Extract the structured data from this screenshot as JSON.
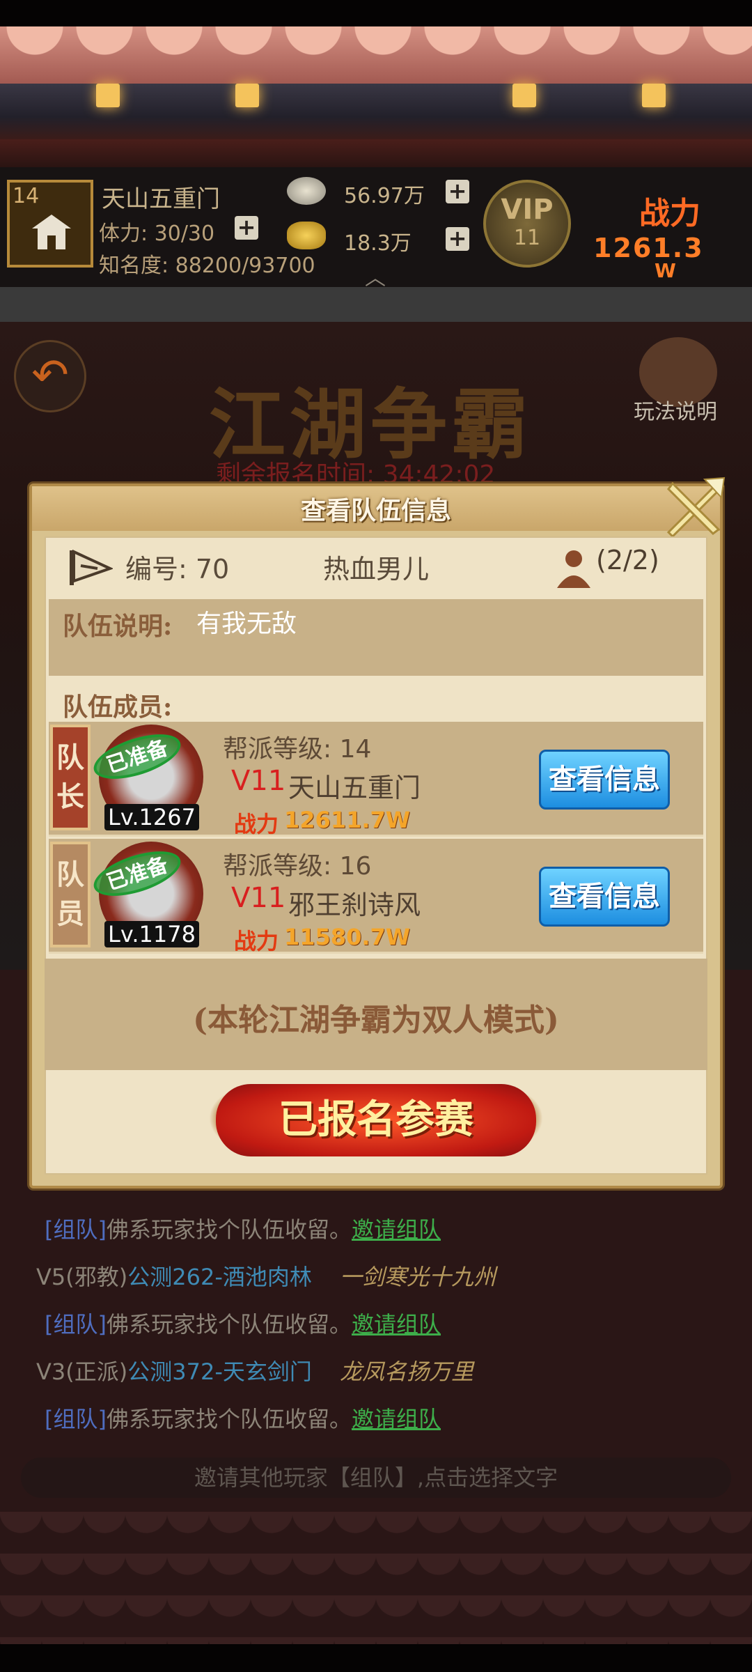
{
  "hud": {
    "portrait_level": "14",
    "player_name": "天山五重门",
    "stamina": "体力: 30/30",
    "fame": "知名度: 88200/93700",
    "silver": "56.97万",
    "gold": "18.3万",
    "vip": "VIP",
    "vip_level": "11",
    "power_label": "战力",
    "power_value": "1261.3",
    "power_unit": "W"
  },
  "scene": {
    "title": "江湖争霸",
    "rules_label": "玩法说明",
    "timer": "剩余报名时间: 34:42:02"
  },
  "dialog": {
    "title": "查看队伍信息",
    "team_id": "编号:  70",
    "team_name": "热血男儿",
    "team_count": "(2/2)",
    "desc_label": "队伍说明:",
    "desc_text": "有我无敌",
    "members_label": "队伍成员:",
    "members": [
      {
        "role": "队长",
        "ready": "已准备",
        "level": "Lv.1267",
        "guild_level": "帮派等级:  14",
        "vip": "V11",
        "name": "天山五重门",
        "power_label": "战力",
        "power": "12611.7W",
        "button": "查看信息"
      },
      {
        "role": "队员",
        "ready": "已准备",
        "level": "Lv.1178",
        "guild_level": "帮派等级:  16",
        "vip": "V11",
        "name": "邪王刹诗风",
        "power_label": "战力",
        "power": "11580.7W",
        "button": "查看信息"
      }
    ],
    "mode_text": "(本轮江湖争霸为双人模式)",
    "signed_button": "已报名参赛"
  },
  "chat": {
    "lines": [
      {
        "prefix": "[组队]",
        "text": "佛系玩家找个队伍收留。",
        "link": "邀请组队"
      },
      {
        "vip": "V5(邪教)",
        "server": "公测262-酒池肉林",
        "title": "一剑寒光十九州"
      },
      {
        "prefix": "[组队]",
        "text": "佛系玩家找个队伍收留。",
        "link": "邀请组队"
      },
      {
        "vip": "V3(正派)",
        "server": "公测372-天玄剑门",
        "title": "龙凤名扬万里"
      },
      {
        "prefix": "[组队]",
        "text": "佛系玩家找个队伍收留。",
        "link": "邀请组队"
      }
    ],
    "input_placeholder": "邀请其他玩家【组队】,点击选择文字"
  }
}
